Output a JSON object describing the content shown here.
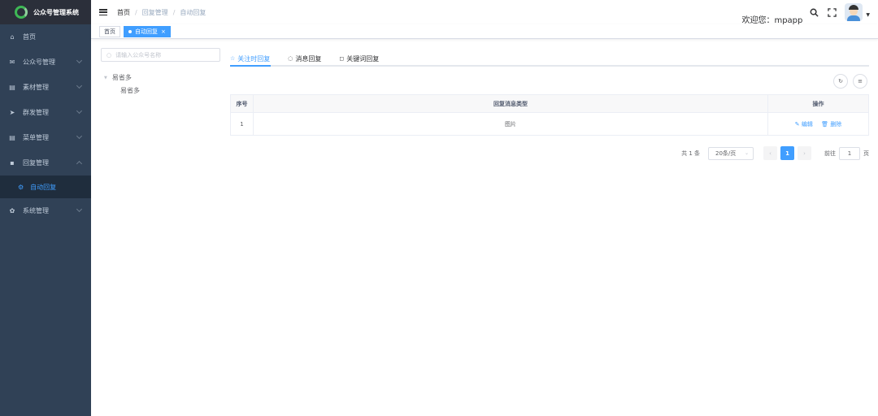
{
  "app": {
    "title": "公众号管理系统",
    "brand_color": "#3eb855"
  },
  "sidebar": {
    "items": [
      {
        "label": "首页",
        "icon": "dashboard-icon",
        "glyph": "⌂"
      },
      {
        "label": "公众号管理",
        "icon": "wechat-icon",
        "glyph": "✉"
      },
      {
        "label": "素材管理",
        "icon": "material-icon",
        "glyph": "▤"
      },
      {
        "label": "群发管理",
        "icon": "send-icon",
        "glyph": "➤"
      },
      {
        "label": "菜单管理",
        "icon": "menu-icon",
        "glyph": "▤"
      },
      {
        "label": "回复管理",
        "icon": "reply-icon",
        "glyph": "▪"
      }
    ],
    "active_sub": {
      "label": "自动回复",
      "icon": "auto-reply-icon",
      "glyph": "⚙"
    },
    "last_item": {
      "label": "系统管理",
      "icon": "settings-icon",
      "glyph": "✿"
    }
  },
  "header": {
    "breadcrumb": [
      "首页",
      "回复管理",
      "自动回复"
    ],
    "welcome": "欢迎您：mpapp"
  },
  "tags": {
    "items": [
      "首页",
      "自动回复"
    ],
    "close": "×"
  },
  "tree": {
    "search_placeholder": "请输入公众号名称",
    "parent": "易省多",
    "child": "易省多"
  },
  "tabs": [
    {
      "label": "关注时回复",
      "glyph": "☆",
      "active": true
    },
    {
      "label": "消息回复",
      "glyph": "◌",
      "active": false
    },
    {
      "label": "关键词回复",
      "glyph": "◻",
      "active": false
    }
  ],
  "table": {
    "headers": [
      "序号",
      "回复消息类型",
      "操作"
    ],
    "rows": [
      {
        "index": "1",
        "type": "图片",
        "edit": "编辑",
        "delete": "删除"
      }
    ]
  },
  "pagination": {
    "total": "共 1 条",
    "page_size": "20条/页",
    "prev": "‹",
    "current": "1",
    "next": "›",
    "goto_label": "前往",
    "goto_value": "1",
    "goto_suffix": "页"
  }
}
